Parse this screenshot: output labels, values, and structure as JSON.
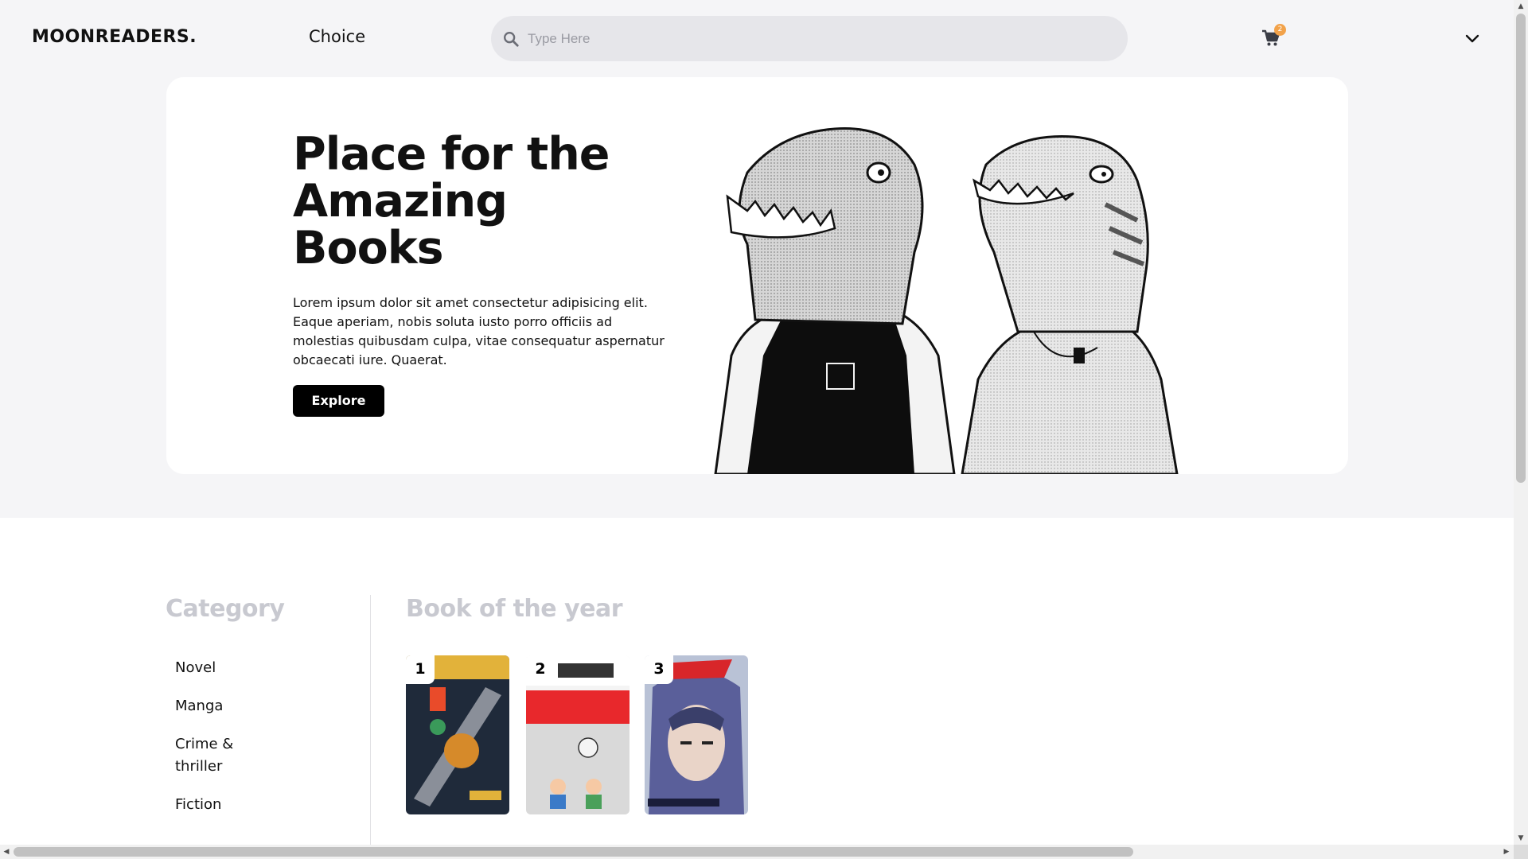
{
  "nav": {
    "logo": "MOONREADERS.",
    "choice_label": "Choice",
    "search_placeholder": "Type Here",
    "search_icon": "search-icon",
    "cart_icon": "shopping-cart-icon",
    "cart_count": "2",
    "menu_icon": "chevron-down-icon",
    "badge_color": "#f2a24a"
  },
  "hero": {
    "title": "Place for the Amazing Books",
    "description": "Lorem ipsum dolor sit amet consectetur adipisicing elit. Eaque aperiam, nobis soluta iusto porro officiis ad molestias quibusdam culpa, vitae consequatur aspernatur obcaecati iure. Quaerat.",
    "explore_label": "Explore",
    "image": "manga-dinosaur-illustration"
  },
  "category": {
    "heading": "Category",
    "items": [
      "Novel",
      "Manga",
      "Crime & thriller",
      "Fiction"
    ]
  },
  "book_of_year": {
    "heading": "Book of the year",
    "books": [
      {
        "rank": "1",
        "cover": "book-cover-sakamoto-days"
      },
      {
        "rank": "2",
        "cover": "book-cover-20th-century-boys"
      },
      {
        "rank": "3",
        "cover": "book-cover-vagabond"
      }
    ]
  },
  "scrollbars": {
    "up_arrow": "▲",
    "down_arrow": "▼",
    "left_arrow": "◀",
    "right_arrow": "▶"
  }
}
